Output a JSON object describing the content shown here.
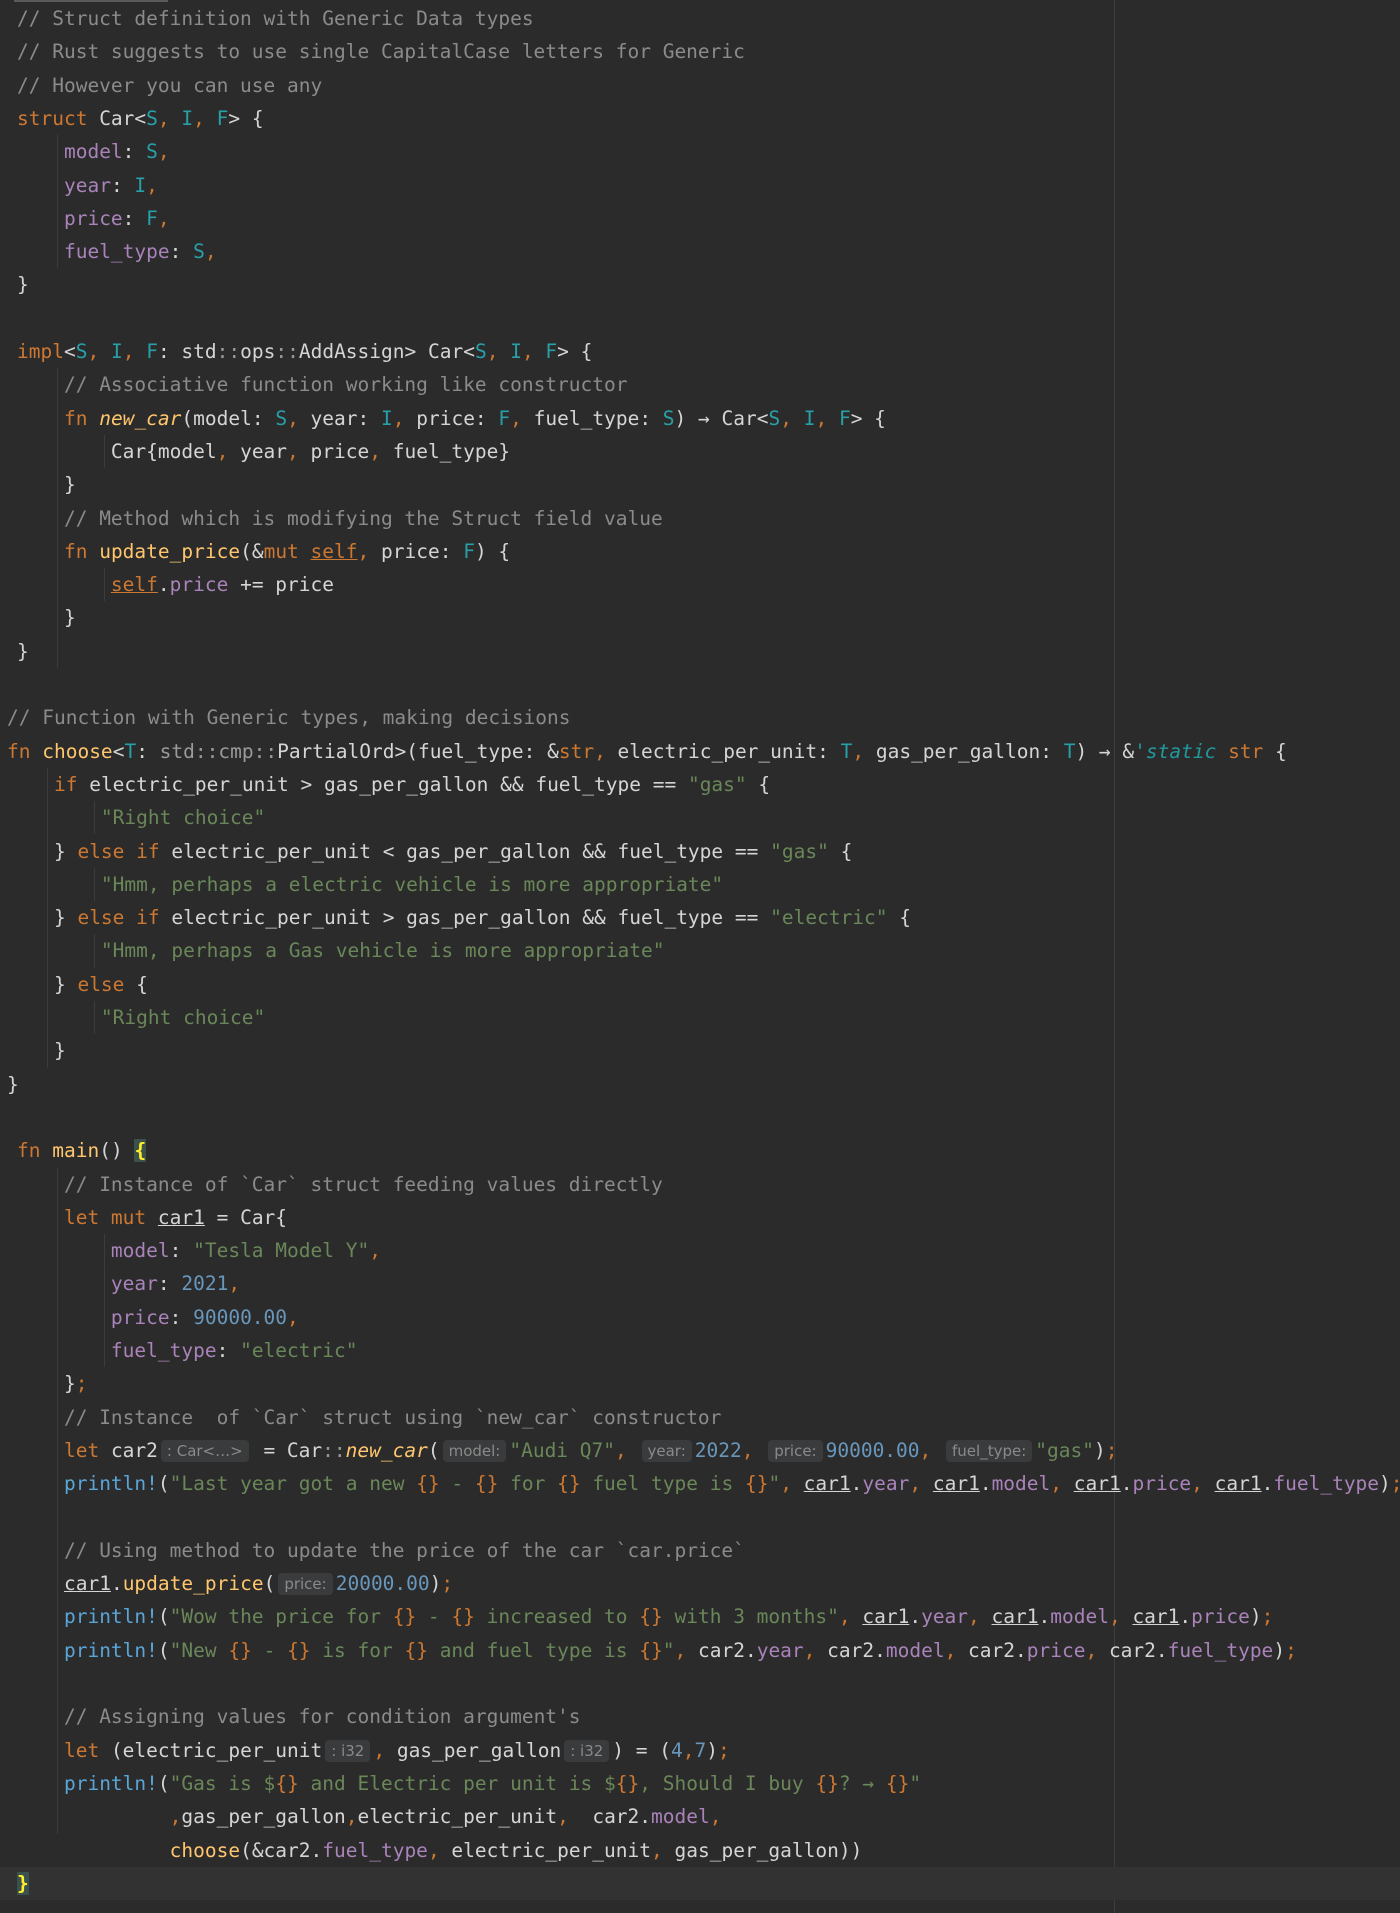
{
  "lines": [
    [
      [
        "cm",
        "// Struct definition with Generic Data types"
      ]
    ],
    [
      [
        "cm",
        "// Rust suggests to use single CapitalCase letters for Generic"
      ]
    ],
    [
      [
        "cm",
        "// However you can use any"
      ]
    ],
    [
      [
        "kw",
        "struct "
      ],
      [
        "p",
        "Car<"
      ],
      [
        "ty",
        "S"
      ],
      [
        "kw",
        ", "
      ],
      [
        "ty",
        "I"
      ],
      [
        "kw",
        ", "
      ],
      [
        "ty",
        "F"
      ],
      [
        "p",
        "> {"
      ]
    ],
    [
      [
        "p",
        "    "
      ],
      [
        "fld",
        "model"
      ],
      [
        "p",
        ": "
      ],
      [
        "ty",
        "S"
      ],
      [
        "kw",
        ","
      ]
    ],
    [
      [
        "p",
        "    "
      ],
      [
        "fld",
        "year"
      ],
      [
        "p",
        ": "
      ],
      [
        "ty",
        "I"
      ],
      [
        "kw",
        ","
      ]
    ],
    [
      [
        "p",
        "    "
      ],
      [
        "fld",
        "price"
      ],
      [
        "p",
        ": "
      ],
      [
        "ty",
        "F"
      ],
      [
        "kw",
        ","
      ]
    ],
    [
      [
        "p",
        "    "
      ],
      [
        "fld",
        "fuel_type"
      ],
      [
        "p",
        ": "
      ],
      [
        "ty",
        "S"
      ],
      [
        "kw",
        ","
      ]
    ],
    [
      [
        "p",
        "}"
      ]
    ],
    [],
    [
      [
        "kw",
        "impl"
      ],
      [
        "p",
        "<"
      ],
      [
        "ty",
        "S"
      ],
      [
        "kw",
        ", "
      ],
      [
        "ty",
        "I"
      ],
      [
        "kw",
        ", "
      ],
      [
        "ty",
        "F"
      ],
      [
        "p",
        ": std"
      ],
      [
        "pth",
        "::"
      ],
      [
        "p",
        "ops"
      ],
      [
        "pth",
        "::"
      ],
      [
        "p",
        "AddAssign> Car<"
      ],
      [
        "ty",
        "S"
      ],
      [
        "kw",
        ", "
      ],
      [
        "ty",
        "I"
      ],
      [
        "kw",
        ", "
      ],
      [
        "ty",
        "F"
      ],
      [
        "p",
        "> {"
      ]
    ],
    [
      [
        "p",
        "    "
      ],
      [
        "cm",
        "// Associative function working like constructor"
      ]
    ],
    [
      [
        "p",
        "    "
      ],
      [
        "kw",
        "fn "
      ],
      [
        "fni",
        "new_car"
      ],
      [
        "p",
        "(model: "
      ],
      [
        "ty",
        "S"
      ],
      [
        "kw",
        ", "
      ],
      [
        "p",
        "year: "
      ],
      [
        "ty",
        "I"
      ],
      [
        "kw",
        ", "
      ],
      [
        "p",
        "price: "
      ],
      [
        "ty",
        "F"
      ],
      [
        "kw",
        ", "
      ],
      [
        "p",
        "fuel_type: "
      ],
      [
        "ty",
        "S"
      ],
      [
        "p",
        ") → Car<"
      ],
      [
        "ty",
        "S"
      ],
      [
        "kw",
        ", "
      ],
      [
        "ty",
        "I"
      ],
      [
        "kw",
        ", "
      ],
      [
        "ty",
        "F"
      ],
      [
        "p",
        "> {"
      ]
    ],
    [
      [
        "p",
        "        Car{model"
      ],
      [
        "kw",
        ", "
      ],
      [
        "p",
        "year"
      ],
      [
        "kw",
        ", "
      ],
      [
        "p",
        "price"
      ],
      [
        "kw",
        ", "
      ],
      [
        "p",
        "fuel_type}"
      ]
    ],
    [
      [
        "p",
        "    }"
      ]
    ],
    [
      [
        "p",
        "    "
      ],
      [
        "cm",
        "// Method which is modifying the Struct field value"
      ]
    ],
    [
      [
        "p",
        "    "
      ],
      [
        "kw",
        "fn "
      ],
      [
        "fn",
        "update_price"
      ],
      [
        "p",
        "(&"
      ],
      [
        "kw",
        "mut "
      ],
      [
        "selfk",
        "self"
      ],
      [
        "kw",
        ", "
      ],
      [
        "p",
        "price: "
      ],
      [
        "ty",
        "F"
      ],
      [
        "p",
        ") {"
      ]
    ],
    [
      [
        "p",
        "        "
      ],
      [
        "selfk",
        "self"
      ],
      [
        "p",
        "."
      ],
      [
        "fld",
        "price"
      ],
      [
        "p",
        " += price"
      ]
    ],
    [
      [
        "p",
        "    }"
      ]
    ],
    [
      [
        "p",
        "}"
      ]
    ],
    [],
    [
      [
        "cm",
        "// Function with Generic types, making decisions"
      ]
    ],
    [
      [
        "kw",
        "fn "
      ],
      [
        "fn",
        "choose"
      ],
      [
        "p",
        "<"
      ],
      [
        "ty",
        "T"
      ],
      [
        "p",
        ": "
      ],
      [
        "pth",
        "std::cmp::"
      ],
      [
        "p",
        "PartialOrd>(fuel_type: &"
      ],
      [
        "kw",
        "str, "
      ],
      [
        "p",
        "electric_per_unit: "
      ],
      [
        "ty",
        "T"
      ],
      [
        "kw",
        ", "
      ],
      [
        "p",
        "gas_per_gallon: "
      ],
      [
        "ty",
        "T"
      ],
      [
        "p",
        ") → &"
      ],
      [
        "lt",
        "'static "
      ],
      [
        "kw",
        "str "
      ],
      [
        "p",
        "{"
      ]
    ],
    [
      [
        "p",
        "    "
      ],
      [
        "kw",
        "if "
      ],
      [
        "p",
        "electric_per_unit > gas_per_gallon && fuel_type == "
      ],
      [
        "str",
        "\"gas\""
      ],
      [
        "p",
        " {"
      ]
    ],
    [
      [
        "p",
        "        "
      ],
      [
        "str",
        "\"Right choice\""
      ]
    ],
    [
      [
        "p",
        "    } "
      ],
      [
        "kw",
        "else if "
      ],
      [
        "p",
        "electric_per_unit < gas_per_gallon && fuel_type == "
      ],
      [
        "str",
        "\"gas\""
      ],
      [
        "p",
        " {"
      ]
    ],
    [
      [
        "p",
        "        "
      ],
      [
        "str",
        "\"Hmm, perhaps a electric vehicle is more appropriate\""
      ]
    ],
    [
      [
        "p",
        "    } "
      ],
      [
        "kw",
        "else if "
      ],
      [
        "p",
        "electric_per_unit > gas_per_gallon && fuel_type == "
      ],
      [
        "str",
        "\"electric\""
      ],
      [
        "p",
        " {"
      ]
    ],
    [
      [
        "p",
        "        "
      ],
      [
        "str",
        "\"Hmm, perhaps a Gas vehicle is more appropriate\""
      ]
    ],
    [
      [
        "p",
        "    } "
      ],
      [
        "kw",
        "else "
      ],
      [
        "p",
        "{"
      ]
    ],
    [
      [
        "p",
        "        "
      ],
      [
        "str",
        "\"Right choice\""
      ]
    ],
    [
      [
        "p",
        "    }"
      ]
    ],
    [
      [
        "p",
        "}"
      ]
    ],
    [],
    [
      [
        "kw",
        "fn "
      ],
      [
        "fn",
        "main"
      ],
      [
        "p",
        "() "
      ],
      [
        "brace",
        "{"
      ]
    ],
    [
      [
        "p",
        "    "
      ],
      [
        "cm",
        "// Instance of `Car` struct feeding values directly"
      ]
    ],
    [
      [
        "p",
        "    "
      ],
      [
        "kw",
        "let mut "
      ],
      [
        "und",
        "car1"
      ],
      [
        "p",
        " = Car{"
      ]
    ],
    [
      [
        "p",
        "        "
      ],
      [
        "fld",
        "model"
      ],
      [
        "p",
        ": "
      ],
      [
        "str",
        "\"Tesla Model Y\""
      ],
      [
        "kw",
        ","
      ]
    ],
    [
      [
        "p",
        "        "
      ],
      [
        "fld",
        "year"
      ],
      [
        "p",
        ": "
      ],
      [
        "num",
        "2021"
      ],
      [
        "kw",
        ","
      ]
    ],
    [
      [
        "p",
        "        "
      ],
      [
        "fld",
        "price"
      ],
      [
        "p",
        ": "
      ],
      [
        "num",
        "90000.00"
      ],
      [
        "kw",
        ","
      ]
    ],
    [
      [
        "p",
        "        "
      ],
      [
        "fld",
        "fuel_type"
      ],
      [
        "p",
        ": "
      ],
      [
        "str",
        "\"electric\""
      ]
    ],
    [
      [
        "p",
        "    }"
      ],
      [
        "kw",
        ";"
      ]
    ],
    [
      [
        "p",
        "    "
      ],
      [
        "cm",
        "// Instance  of `Car` struct using `new_car` constructor"
      ]
    ],
    [
      [
        "p",
        "    "
      ],
      [
        "kw",
        "let "
      ],
      [
        "p",
        "car2"
      ],
      [
        "hint",
        ": Car<…>"
      ],
      [
        "p",
        " = Car"
      ],
      [
        "pth",
        "::"
      ],
      [
        "fni",
        "new_car"
      ],
      [
        "p",
        "("
      ],
      [
        "hint",
        "model:"
      ],
      [
        "str",
        "\"Audi Q7\""
      ],
      [
        "kw",
        ", "
      ],
      [
        "hint",
        "year:"
      ],
      [
        "num",
        "2022"
      ],
      [
        "kw",
        ", "
      ],
      [
        "hint",
        "price:"
      ],
      [
        "num",
        "90000.00"
      ],
      [
        "kw",
        ", "
      ],
      [
        "hint",
        "fuel_type:"
      ],
      [
        "str",
        "\"gas\""
      ],
      [
        "p",
        ")"
      ],
      [
        "kw",
        ";"
      ]
    ],
    [
      [
        "p",
        "    "
      ],
      [
        "mac",
        "println!"
      ],
      [
        "p",
        "("
      ],
      [
        "str",
        "\"Last year got a new "
      ],
      [
        "kw",
        "{}"
      ],
      [
        "str",
        " - "
      ],
      [
        "kw",
        "{}"
      ],
      [
        "str",
        " for "
      ],
      [
        "kw",
        "{}"
      ],
      [
        "str",
        " fuel type is "
      ],
      [
        "kw",
        "{}"
      ],
      [
        "str",
        "\""
      ],
      [
        "kw",
        ", "
      ],
      [
        "und",
        "car1"
      ],
      [
        "p",
        "."
      ],
      [
        "fld",
        "year"
      ],
      [
        "kw",
        ", "
      ],
      [
        "und",
        "car1"
      ],
      [
        "p",
        "."
      ],
      [
        "fld",
        "model"
      ],
      [
        "kw",
        ", "
      ],
      [
        "und",
        "car1"
      ],
      [
        "p",
        "."
      ],
      [
        "fld",
        "price"
      ],
      [
        "kw",
        ", "
      ],
      [
        "und",
        "car1"
      ],
      [
        "p",
        "."
      ],
      [
        "fld",
        "fuel_type"
      ],
      [
        "p",
        ")"
      ],
      [
        "kw",
        ";"
      ]
    ],
    [],
    [
      [
        "p",
        "    "
      ],
      [
        "cm",
        "// Using method to update the price of the car `car.price`"
      ]
    ],
    [
      [
        "p",
        "    "
      ],
      [
        "und",
        "car1"
      ],
      [
        "p",
        "."
      ],
      [
        "fn",
        "update_price"
      ],
      [
        "p",
        "("
      ],
      [
        "hint",
        "price:"
      ],
      [
        "num",
        "20000.00"
      ],
      [
        "p",
        ")"
      ],
      [
        "kw",
        ";"
      ]
    ],
    [
      [
        "p",
        "    "
      ],
      [
        "mac",
        "println!"
      ],
      [
        "p",
        "("
      ],
      [
        "str",
        "\"Wow the price for "
      ],
      [
        "kw",
        "{}"
      ],
      [
        "str",
        " - "
      ],
      [
        "kw",
        "{}"
      ],
      [
        "str",
        " increased to "
      ],
      [
        "kw",
        "{}"
      ],
      [
        "str",
        " with 3 months\""
      ],
      [
        "kw",
        ", "
      ],
      [
        "und",
        "car1"
      ],
      [
        "p",
        "."
      ],
      [
        "fld",
        "year"
      ],
      [
        "kw",
        ", "
      ],
      [
        "und",
        "car1"
      ],
      [
        "p",
        "."
      ],
      [
        "fld",
        "model"
      ],
      [
        "kw",
        ", "
      ],
      [
        "und",
        "car1"
      ],
      [
        "p",
        "."
      ],
      [
        "fld",
        "price"
      ],
      [
        "p",
        ")"
      ],
      [
        "kw",
        ";"
      ]
    ],
    [
      [
        "p",
        "    "
      ],
      [
        "mac",
        "println!"
      ],
      [
        "p",
        "("
      ],
      [
        "str",
        "\"New "
      ],
      [
        "kw",
        "{}"
      ],
      [
        "str",
        " - "
      ],
      [
        "kw",
        "{}"
      ],
      [
        "str",
        " is for "
      ],
      [
        "kw",
        "{}"
      ],
      [
        "str",
        " and fuel type is "
      ],
      [
        "kw",
        "{}"
      ],
      [
        "str",
        "\""
      ],
      [
        "kw",
        ", "
      ],
      [
        "p",
        "car2."
      ],
      [
        "fld",
        "year"
      ],
      [
        "kw",
        ", "
      ],
      [
        "p",
        "car2."
      ],
      [
        "fld",
        "model"
      ],
      [
        "kw",
        ", "
      ],
      [
        "p",
        "car2."
      ],
      [
        "fld",
        "price"
      ],
      [
        "kw",
        ", "
      ],
      [
        "p",
        "car2."
      ],
      [
        "fld",
        "fuel_type"
      ],
      [
        "p",
        ")"
      ],
      [
        "kw",
        ";"
      ]
    ],
    [],
    [
      [
        "p",
        "    "
      ],
      [
        "cm",
        "// Assigning values for condition argument's"
      ]
    ],
    [
      [
        "p",
        "    "
      ],
      [
        "kw",
        "let "
      ],
      [
        "p",
        "(electric_per_unit"
      ],
      [
        "hint",
        ": i32"
      ],
      [
        "kw",
        ", "
      ],
      [
        "p",
        "gas_per_gallon"
      ],
      [
        "hint",
        ": i32"
      ],
      [
        "p",
        ") = ("
      ],
      [
        "num",
        "4"
      ],
      [
        "kw",
        ","
      ],
      [
        "num",
        "7"
      ],
      [
        "p",
        ")"
      ],
      [
        "kw",
        ";"
      ]
    ],
    [
      [
        "p",
        "    "
      ],
      [
        "mac",
        "println!"
      ],
      [
        "p",
        "("
      ],
      [
        "str",
        "\"Gas is $"
      ],
      [
        "kw",
        "{}"
      ],
      [
        "str",
        " and Electric per unit is $"
      ],
      [
        "kw",
        "{}"
      ],
      [
        "str",
        ", Should I buy "
      ],
      [
        "kw",
        "{}"
      ],
      [
        "str",
        "? → "
      ],
      [
        "kw",
        "{}"
      ],
      [
        "str",
        "\""
      ]
    ],
    [
      [
        "p",
        "             "
      ],
      [
        "kw",
        ","
      ],
      [
        "p",
        "gas_per_gallon"
      ],
      [
        "kw",
        ","
      ],
      [
        "p",
        "electric_per_unit"
      ],
      [
        "kw",
        ",  "
      ],
      [
        "p",
        "car2."
      ],
      [
        "fld",
        "model"
      ],
      [
        "kw",
        ","
      ]
    ],
    [
      [
        "p",
        "             "
      ],
      [
        "fn",
        "choose"
      ],
      [
        "p",
        "(&car2."
      ],
      [
        "fld",
        "fuel_type"
      ],
      [
        "kw",
        ", "
      ],
      [
        "p",
        "electric_per_unit"
      ],
      [
        "kw",
        ", "
      ],
      [
        "p",
        "gas_per_gallon))"
      ]
    ],
    [
      [
        "brace",
        "}"
      ]
    ]
  ]
}
